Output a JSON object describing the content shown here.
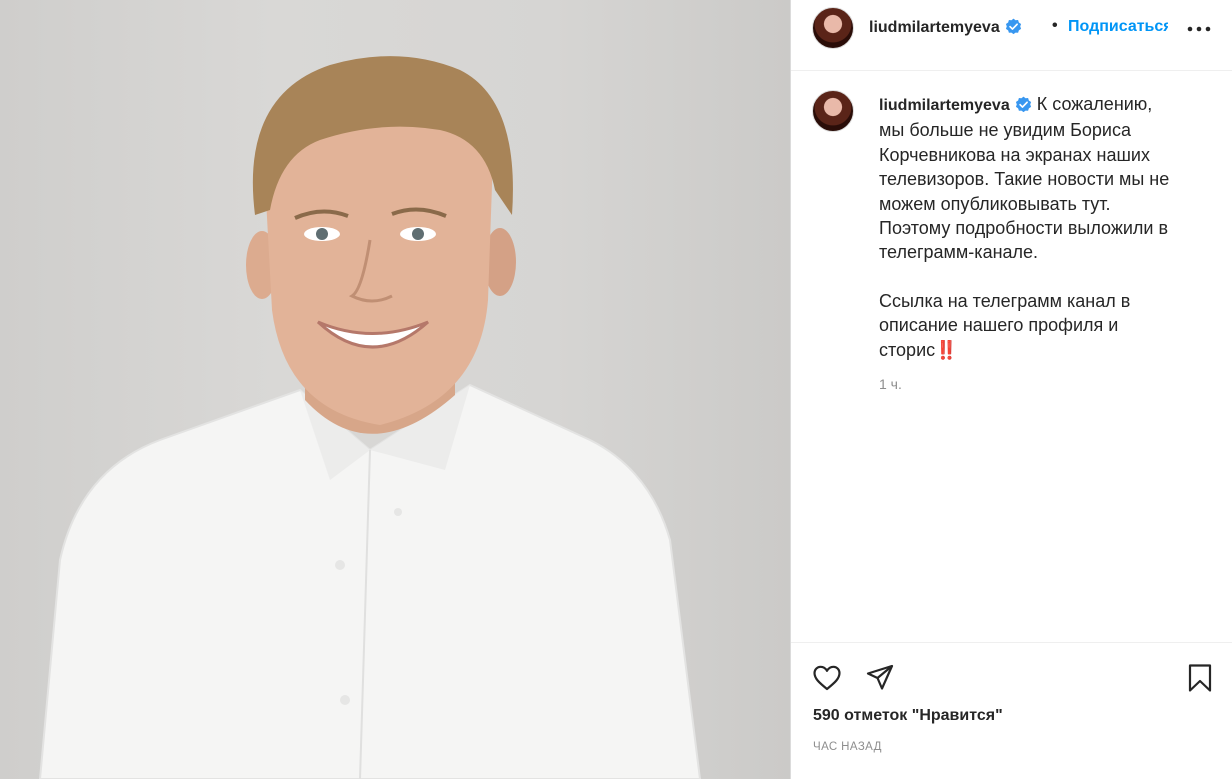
{
  "post": {
    "author": "liudmilartemyeva",
    "follow_label": "Подписаться",
    "separator": "•",
    "caption_first_line": "К сожалению,",
    "caption_lines": [
      "мы больше не увидим Бориса",
      "Корчевникова на экранах наших",
      "телевизоров. Такие новости мы не",
      "можем опубликовывать тут.",
      "Поэтому подробности выложили в",
      "телеграмм-канале."
    ],
    "caption_lines_2": [
      "Ссылка на телеграмм канал в",
      "описание нашего профиля и",
      "сторис‼️"
    ],
    "comment_time": "1 ч.",
    "likes_text": "590 отметок \"Нравится\"",
    "posted_ago": "ЧАС НАЗАД"
  },
  "icons": {
    "verified": "verified-badge-icon",
    "more": "more-options-icon",
    "like": "heart-icon",
    "share": "paper-plane-icon",
    "save": "bookmark-icon"
  },
  "colors": {
    "accent": "#0095f6",
    "verified": "#3897f0",
    "text": "#262626",
    "muted": "#8e8e8e"
  }
}
